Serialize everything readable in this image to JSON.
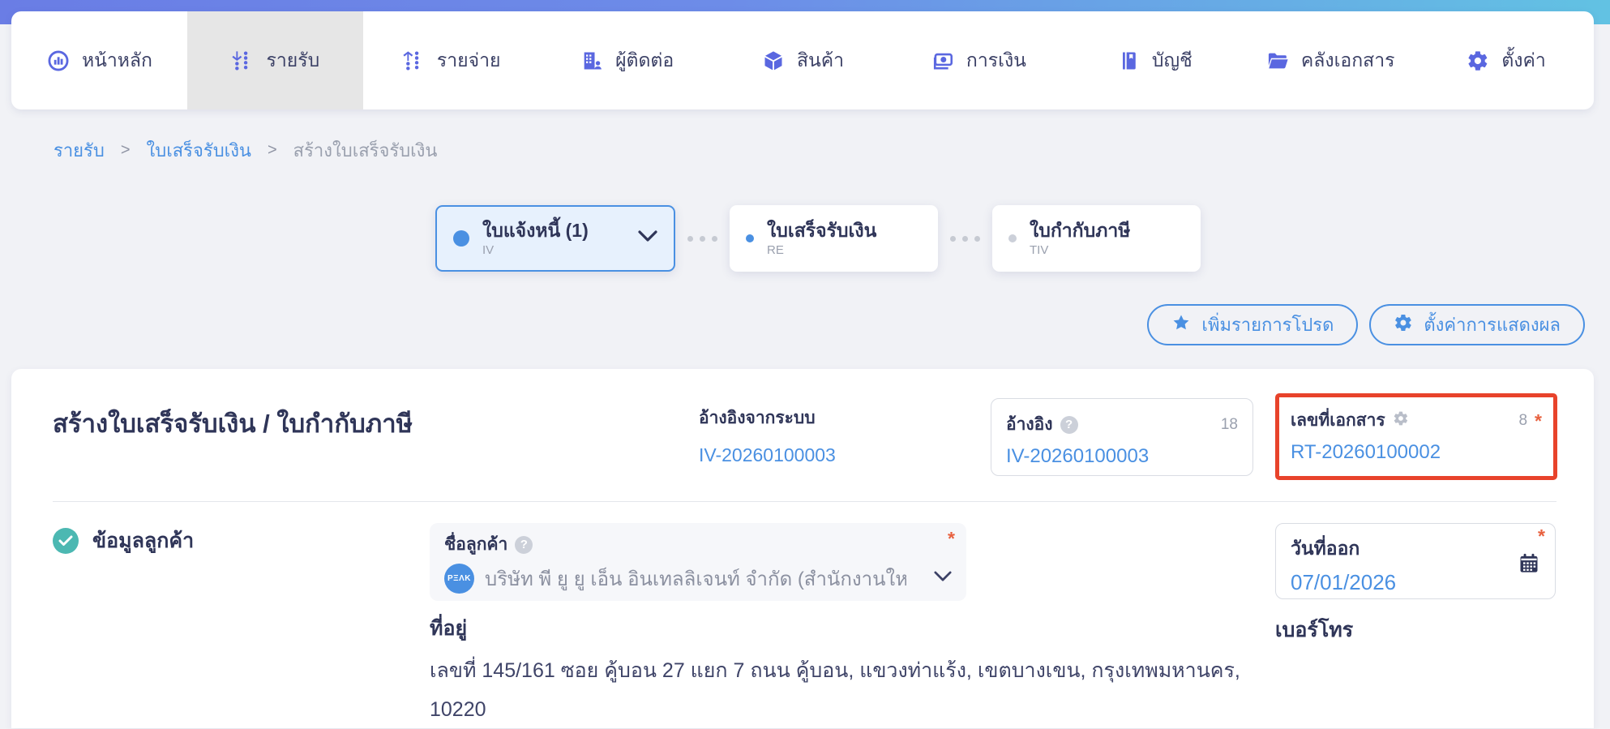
{
  "nav": {
    "items": [
      {
        "label": "หน้าหลัก",
        "icon": "dashboard-icon"
      },
      {
        "label": "รายรับ",
        "icon": "income-icon",
        "active": true
      },
      {
        "label": "รายจ่าย",
        "icon": "expense-icon"
      },
      {
        "label": "ผู้ติดต่อ",
        "icon": "contacts-icon"
      },
      {
        "label": "สินค้า",
        "icon": "product-cube-icon"
      },
      {
        "label": "การเงิน",
        "icon": "money-icon"
      },
      {
        "label": "บัญชี",
        "icon": "ledger-icon"
      },
      {
        "label": "คลังเอกสาร",
        "icon": "folder-icon"
      },
      {
        "label": "ตั้งค่า",
        "icon": "gear-icon"
      }
    ]
  },
  "breadcrumb": {
    "separator": ">",
    "items": [
      "รายรับ",
      "ใบเสร็จรับเงิน",
      "สร้างใบเสร็จรับเงิน"
    ]
  },
  "stepper": {
    "steps": [
      {
        "label": "ใบแจ้งหนี้ (1)",
        "code": "IV",
        "state": "active-dropdown"
      },
      {
        "label": "ใบเสร็จรับเงิน",
        "code": "RE",
        "state": "current"
      },
      {
        "label": "ใบกำกับภาษี",
        "code": "TIV",
        "state": "upcoming"
      }
    ]
  },
  "actions": {
    "favorite_label": "เพิ่มรายการโปรด",
    "display_settings_label": "ตั้งค่าการแสดงผล"
  },
  "document": {
    "title": "สร้างใบเสร็จรับเงิน / ใบกำกับภาษี",
    "system_reference": {
      "label": "อ้างอิงจากระบบ",
      "value": "IV-20260100003"
    },
    "reference": {
      "label": "อ้างอิง",
      "value": "IV-20260100003",
      "count": "18"
    },
    "doc_number": {
      "label": "เลขที่เอกสาร",
      "value": "RT-20260100002",
      "count": "8",
      "required_mark": "*"
    }
  },
  "customer": {
    "section_title": "ข้อมูลลูกค้า",
    "name": {
      "label": "ชื่อลูกค้า",
      "value": "บริษัท พี ยู ยู เอ็น อินเทลลิเจนท์ จำกัด (สำนักงานให...",
      "avatar_text": "PΞΛK",
      "required_mark": "*"
    },
    "address": {
      "label": "ที่อยู่",
      "value": "เลขที่ 145/161 ซอย คู้บอน 27 แยก 7 ถนน คู้บอน, แขวงท่าแร้ง, เขตบางเขน, กรุงเทพมหานคร, 10220"
    },
    "issue_date": {
      "label": "วันที่ออก",
      "value": "07/01/2026",
      "required_mark": "*"
    },
    "phone": {
      "label": "เบอร์โทร"
    }
  },
  "icons": {
    "help_glyph": "?"
  },
  "colors": {
    "accent_blue": "#4a90e2",
    "nav_purple": "#5a67e0",
    "highlight_red": "#e8432b",
    "required_red": "#e8613f",
    "check_teal": "#4cb8b2",
    "dark_navy": "#2f3558"
  }
}
